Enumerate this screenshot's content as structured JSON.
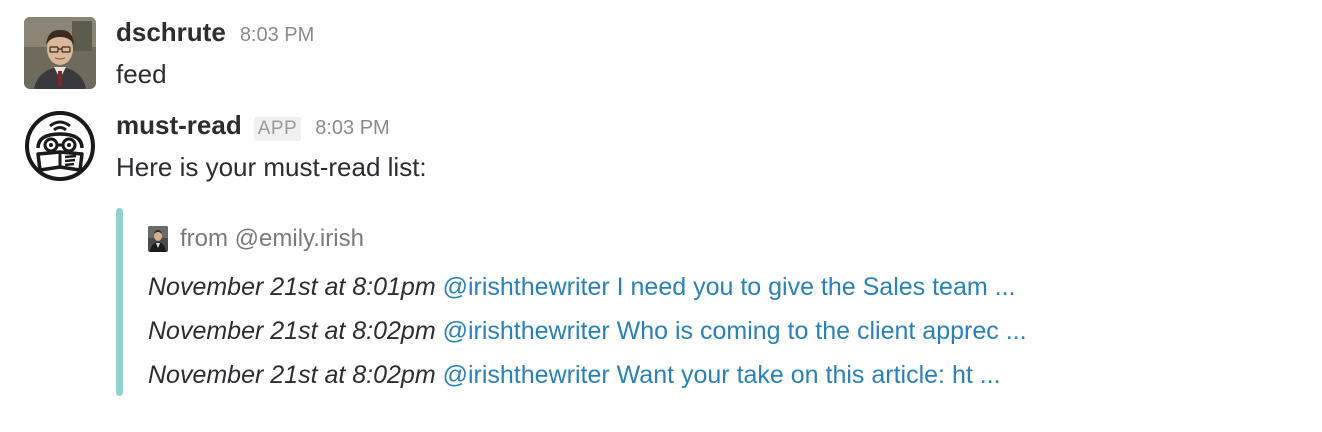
{
  "messages": [
    {
      "username": "dschrute",
      "time": "8:03 PM",
      "text": "feed"
    },
    {
      "username": "must-read",
      "badge": "APP",
      "time": "8:03 PM",
      "text": "Here is your must-read list:"
    }
  ],
  "attachment": {
    "author": "from @emily.irish",
    "bar_color": "#92d1ce",
    "items": [
      {
        "date": "November 21st at 8:01pm",
        "link": "@irishthewriter I need you to give the Sales team ..."
      },
      {
        "date": "November 21st at 8:02pm",
        "link": "@irishthewriter Who is coming to the client apprec ..."
      },
      {
        "date": "November 21st at 8:02pm",
        "link": "@irishthewriter Want your take on this article: ht ..."
      }
    ]
  },
  "colors": {
    "link": "#2a80b9",
    "text": "#2c2d30",
    "muted": "#8b8b8f"
  }
}
